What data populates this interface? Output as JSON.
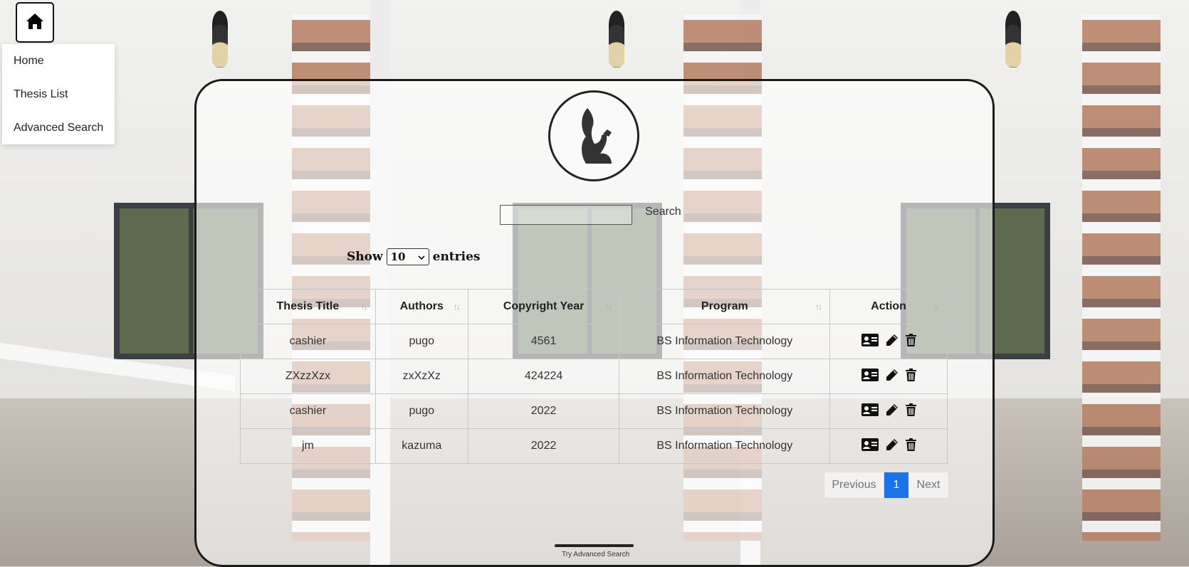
{
  "nav": {
    "menu": [
      "Home",
      "Thesis List",
      "Advanced Search"
    ]
  },
  "search": {
    "placeholder": "",
    "button_label": "Search"
  },
  "entries": {
    "show_label": "Show",
    "value": "10",
    "entries_label": "entries"
  },
  "table": {
    "headers": [
      "Thesis Title",
      "Authors",
      "Copyright Year",
      "Program",
      "Action"
    ],
    "rows": [
      {
        "title": "cashier",
        "authors": "pugo",
        "year": "4561",
        "program": "BS Information Technology"
      },
      {
        "title": "ZXzzXzx",
        "authors": "zxXzXz",
        "year": "424224",
        "program": "BS Information Technology"
      },
      {
        "title": "cashier",
        "authors": "pugo",
        "year": "2022",
        "program": "BS Information Technology"
      },
      {
        "title": "jm",
        "authors": "kazuma",
        "year": "2022",
        "program": "BS Information Technology"
      }
    ]
  },
  "pagination": {
    "previous": "Previous",
    "current": "1",
    "next": "Next"
  },
  "footer": {
    "advanced_link": "Try Advanced Search"
  },
  "colors": {
    "accent": "#1a73e8",
    "panel_border": "#1b1b1b"
  },
  "icons": {
    "home": "home-icon",
    "view": "id-card-icon",
    "edit": "pencil-icon",
    "delete": "trash-icon"
  }
}
